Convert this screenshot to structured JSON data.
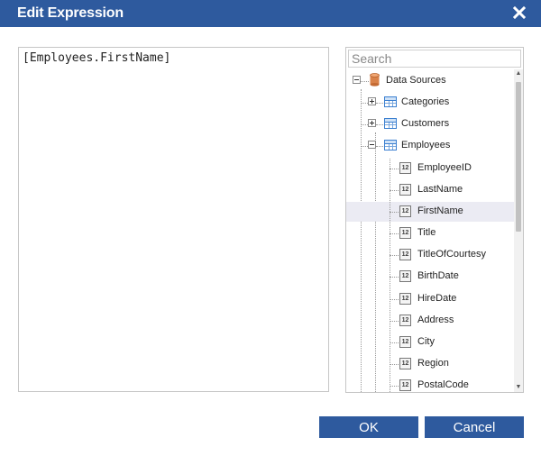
{
  "dialog": {
    "title": "Edit Expression"
  },
  "editor": {
    "expression": "[Employees.FirstName]"
  },
  "search": {
    "placeholder": "Search"
  },
  "tree": {
    "root": {
      "label": "Data Sources",
      "expanded": true
    },
    "tables": [
      {
        "label": "Categories",
        "expanded": false
      },
      {
        "label": "Customers",
        "expanded": false
      },
      {
        "label": "Employees",
        "expanded": true
      }
    ],
    "fields": [
      {
        "label": "EmployeeID",
        "icon": "12"
      },
      {
        "label": "LastName",
        "icon": "12"
      },
      {
        "label": "FirstName",
        "icon": "12",
        "selected": true
      },
      {
        "label": "Title",
        "icon": "12"
      },
      {
        "label": "TitleOfCourtesy",
        "icon": "12"
      },
      {
        "label": "BirthDate",
        "icon": "12"
      },
      {
        "label": "HireDate",
        "icon": "12"
      },
      {
        "label": "Address",
        "icon": "12"
      },
      {
        "label": "City",
        "icon": "12"
      },
      {
        "label": "Region",
        "icon": "12"
      },
      {
        "label": "PostalCode",
        "icon": "12"
      }
    ]
  },
  "buttons": {
    "ok": "OK",
    "cancel": "Cancel"
  },
  "colors": {
    "accent": "#2e5a9e",
    "selected_row": "#ebebf3"
  }
}
